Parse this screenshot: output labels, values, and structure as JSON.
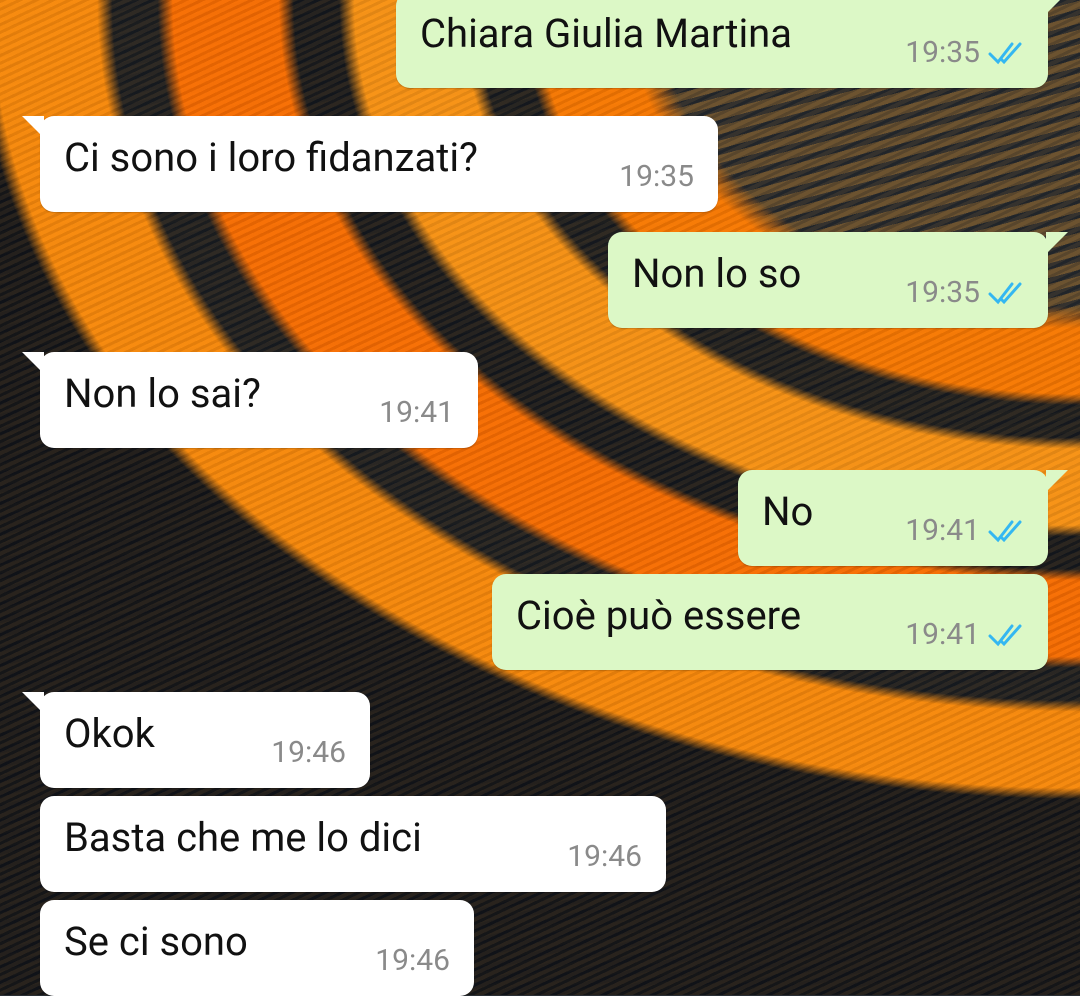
{
  "messages": [
    {
      "text": "Chiara Giulia Martina",
      "time": "19:35",
      "read": true
    },
    {
      "text": "Ci sono i loro fidanzati?",
      "time": "19:35"
    },
    {
      "text": "Non lo so",
      "time": "19:35",
      "read": true
    },
    {
      "text": "Non lo sai?",
      "time": "19:41"
    },
    {
      "text": "No",
      "time": "19:41",
      "read": true
    },
    {
      "text": "Cioè può essere",
      "time": "19:41",
      "read": true
    },
    {
      "text": "Okok",
      "time": "19:46"
    },
    {
      "text": "Basta che me lo dici",
      "time": "19:46"
    },
    {
      "text": "Se ci sono",
      "time": "19:46"
    }
  ],
  "colors": {
    "incoming_bubble": "#ffffff",
    "outgoing_bubble": "#dcf8c6",
    "read_tick": "#34b7f1",
    "wallpaper_primary": "#ff7a00",
    "wallpaper_dark": "#1a1f25"
  }
}
